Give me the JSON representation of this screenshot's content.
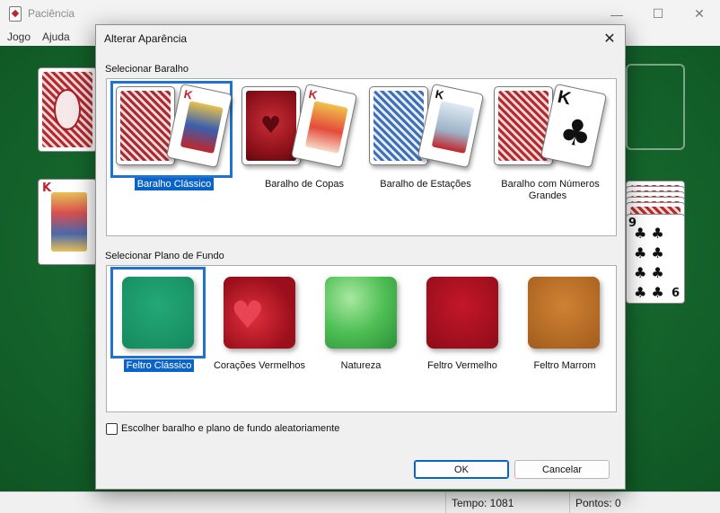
{
  "window": {
    "title": "Paciência",
    "menu": [
      "Jogo",
      "Ajuda"
    ],
    "controls": {
      "minimize": "—",
      "maximize": "☐",
      "close": "✕"
    }
  },
  "status": {
    "time": "Tempo: 1081",
    "points": "Pontos: 0"
  },
  "dialog": {
    "title": "Alterar Aparência",
    "close": "✕",
    "deck_section": "Selecionar Baralho",
    "background_section": "Selecionar Plano de Fundo",
    "decks": [
      {
        "label": "Baralho Clássico",
        "selected": true
      },
      {
        "label": "Baralho de Copas",
        "selected": false
      },
      {
        "label": "Baralho de Estações",
        "selected": false
      },
      {
        "label": "Baralho com Números Grandes",
        "selected": false
      }
    ],
    "backgrounds": [
      {
        "label": "Feltro Clássico",
        "selected": true,
        "color": "#1a9a6c"
      },
      {
        "label": "Corações Vermelhos",
        "selected": false,
        "color": "#b8141f"
      },
      {
        "label": "Natureza",
        "selected": false,
        "color": "#4fbf55"
      },
      {
        "label": "Feltro Vermelho",
        "selected": false,
        "color": "#a8101e"
      },
      {
        "label": "Feltro Marrom",
        "selected": false,
        "color": "#b66a25"
      }
    ],
    "random_checkbox": {
      "label": "Escolher baralho e plano de fundo aleatoriamente",
      "checked": false
    },
    "ok_button": "OK",
    "cancel_button": "Cancelar"
  },
  "game_cards": {
    "king_rank": "K",
    "nine_rank": "9",
    "six_rank": "6"
  }
}
